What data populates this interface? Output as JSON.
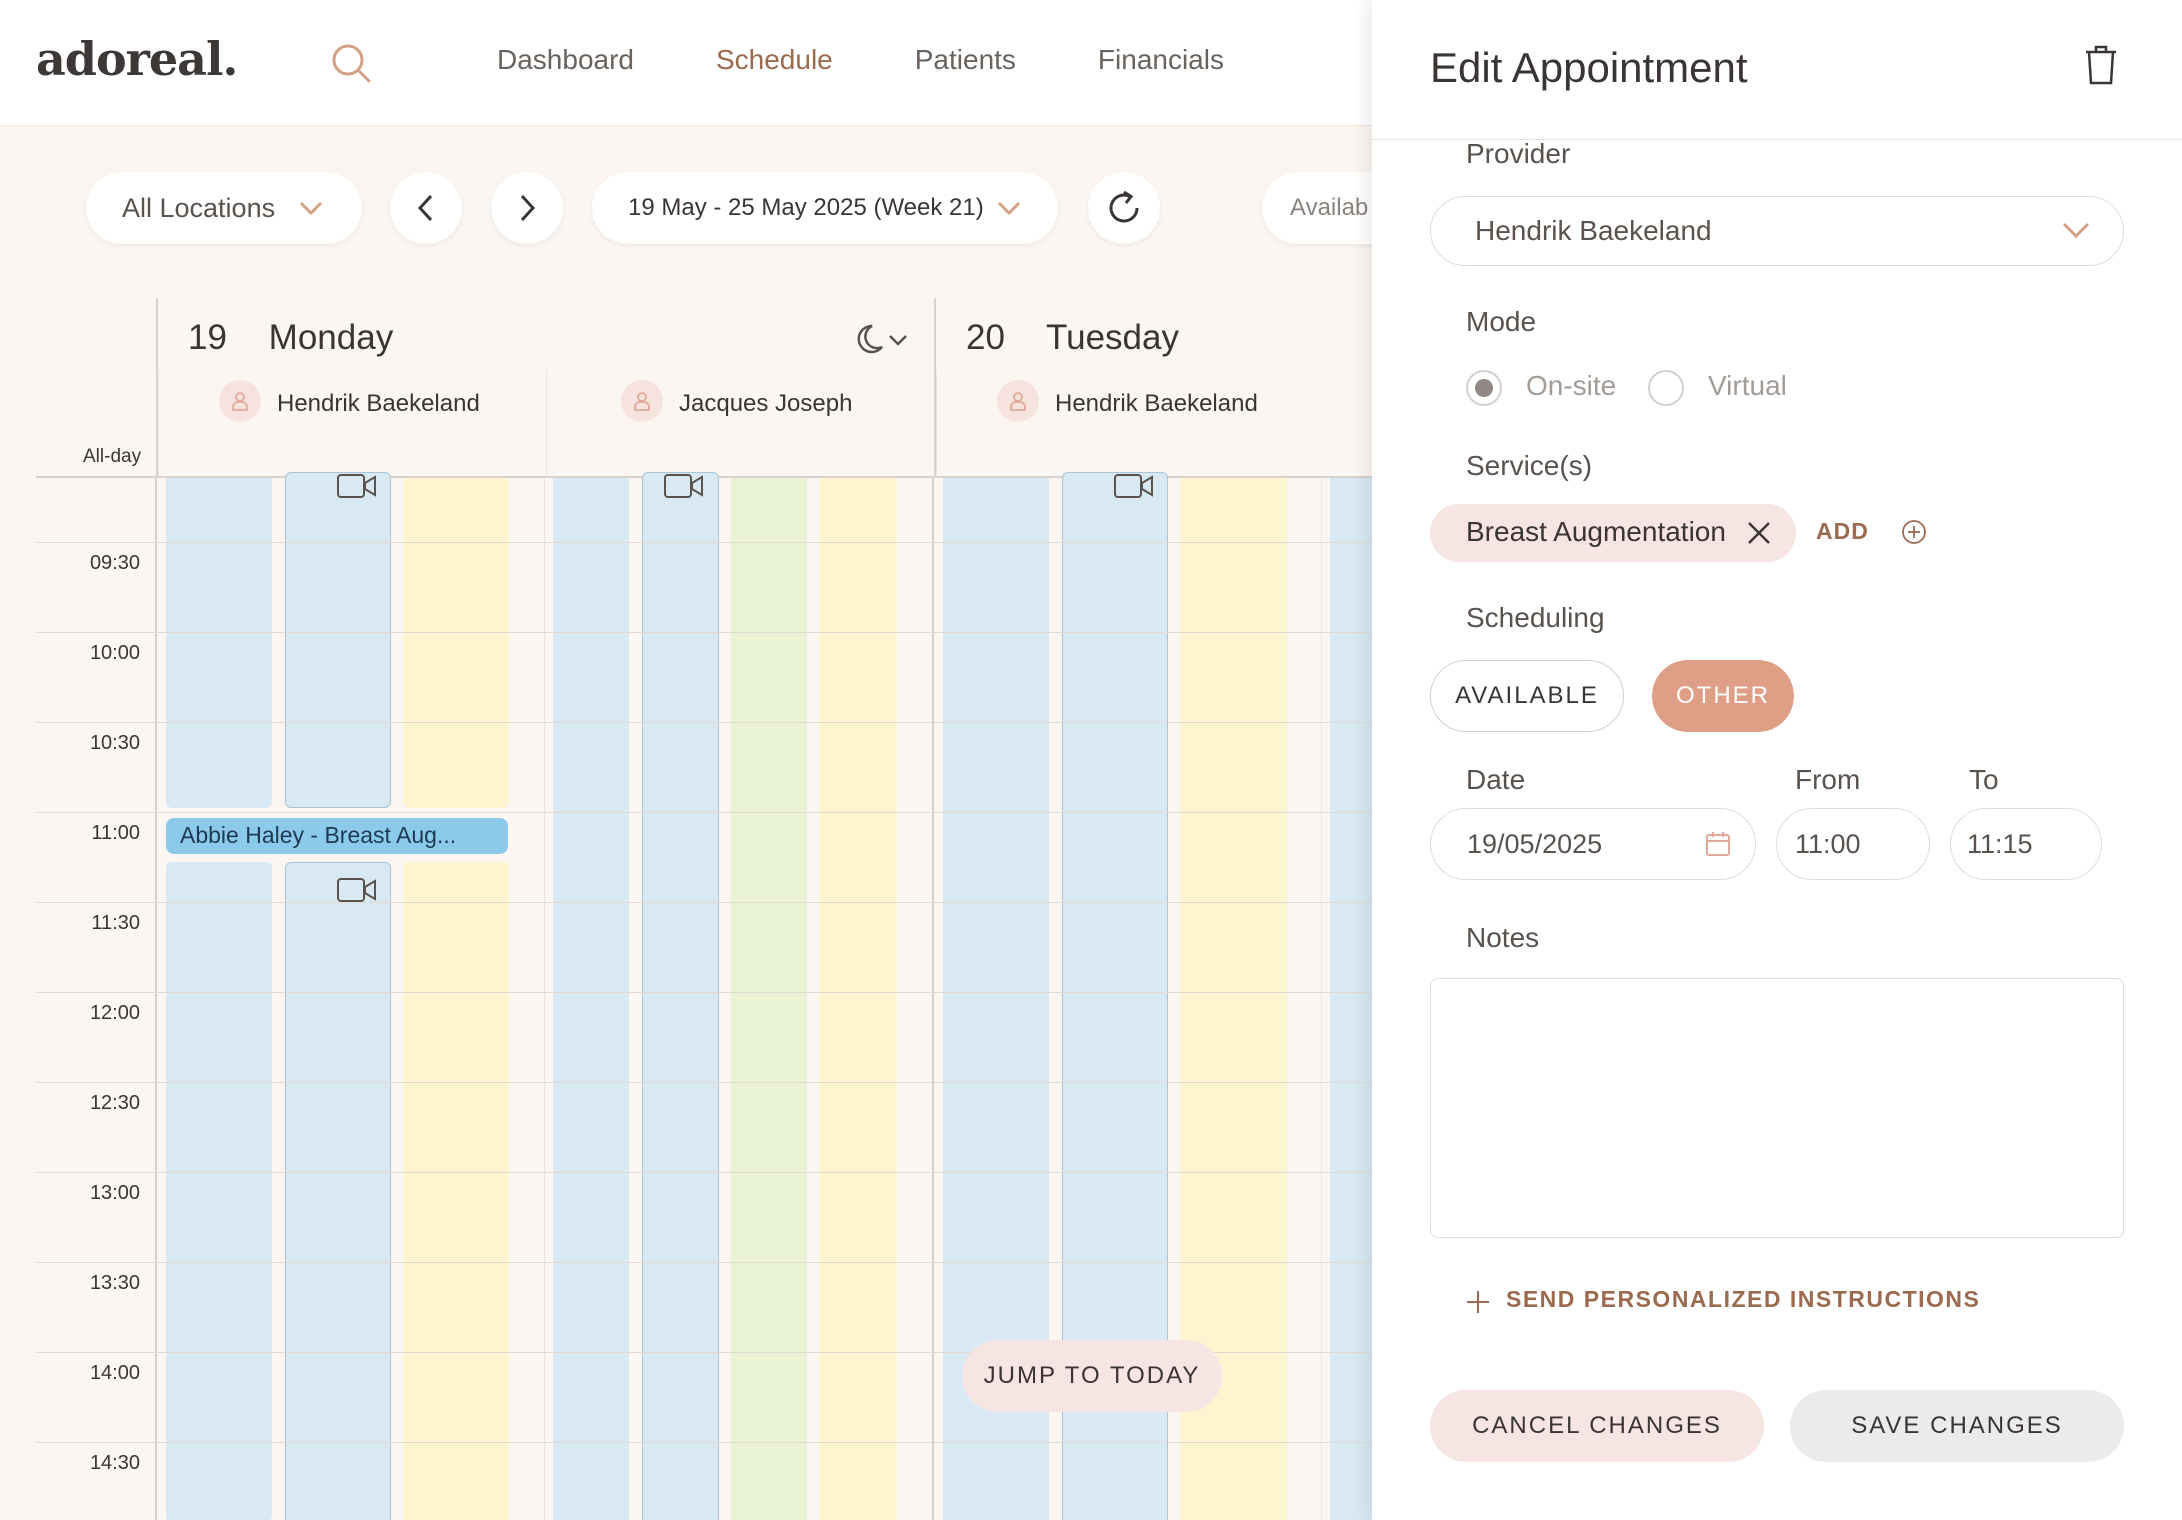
{
  "app": {
    "logo": "adoreal."
  },
  "nav": {
    "items": [
      "Dashboard",
      "Schedule",
      "Patients",
      "Financials"
    ],
    "active": "Schedule"
  },
  "toolbar": {
    "location": "All Locations",
    "week_range": "19 May - 25 May 2025 (Week 21)",
    "availability_label": "Availab"
  },
  "calendar": {
    "allday_label": "All-day",
    "days": [
      {
        "num": "19",
        "name": "Monday",
        "providers": [
          "Hendrik Baekeland",
          "Jacques Joseph"
        ]
      },
      {
        "num": "20",
        "name": "Tuesday",
        "providers": [
          "Hendrik Baekeland"
        ]
      }
    ],
    "times": [
      "09:30",
      "10:00",
      "10:30",
      "11:00",
      "11:30",
      "12:00",
      "12:30",
      "13:00",
      "13:30",
      "14:00",
      "14:30"
    ],
    "appointment": "Abbie Haley - Breast Aug...",
    "jump_to_today": "JUMP TO TODAY"
  },
  "panel": {
    "title": "Edit Appointment",
    "provider_label": "Provider",
    "provider_value": "Hendrik Baekeland",
    "mode_label": "Mode",
    "mode_options": [
      "On-site",
      "Virtual"
    ],
    "mode_selected": "On-site",
    "services_label": "Service(s)",
    "service_chip": "Breast Augmentation",
    "add_label": "ADD",
    "scheduling_label": "Scheduling",
    "scheduling_options": [
      "AVAILABLE",
      "OTHER"
    ],
    "scheduling_selected": "OTHER",
    "date_label": "Date",
    "date_value": "19/05/2025",
    "from_label": "From",
    "from_value": "11:00",
    "to_label": "To",
    "to_value": "11:15",
    "notes_label": "Notes",
    "notes_value": "",
    "send_instructions": "SEND PERSONALIZED INSTRUCTIONS",
    "cancel_label": "CANCEL CHANGES",
    "save_label": "SAVE CHANGES"
  },
  "colors": {
    "accent": "#9b6a4f",
    "other_active": "#df9e86",
    "slot_blue": "#d8e9f4",
    "slot_yellow": "#fcf5d0",
    "slot_green": "#e9f3d3",
    "appointment": "#8ccaec"
  }
}
